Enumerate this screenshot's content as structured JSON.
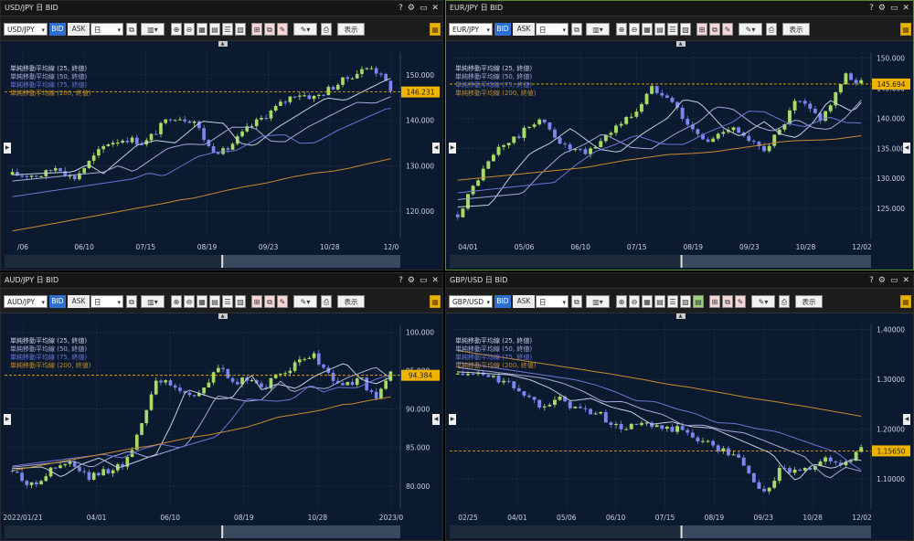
{
  "colors": {
    "bg": "#0b1a2e",
    "grid": "#24364f",
    "bull": "#a6dc66",
    "bear": "#7b86f0",
    "ma25": "#c7d0e3",
    "ma50": "#a7a9dc",
    "ma75": "#6f74d8",
    "ma200": "#c58b2e",
    "price": "#f0b400",
    "axis": "#c9d3e0"
  },
  "common": {
    "bid": "BID",
    "ask": "ASK",
    "period": "日",
    "display": "表示",
    "help": "?",
    "settings": "⚙",
    "window": "▭",
    "close": "✕",
    "legend": [
      "単純移動平均線 (25, 終値)",
      "単純移動平均線 (50, 終値)",
      "単純移動平均線 (75, 終値)",
      "単純移動平均線 (200, 終値)"
    ]
  },
  "panels": [
    {
      "title": "USD/JPY 日 BID",
      "symbol": "USD/JPY",
      "ylim": [
        114,
        155
      ],
      "yticks": [
        "120.000",
        "130.000",
        "140.000",
        "150.000"
      ],
      "ytickvals": [
        120,
        130,
        140,
        150
      ],
      "xticks": [
        "/06",
        "06/10",
        "07/15",
        "08/19",
        "09/23",
        "10/28",
        "12/0"
      ],
      "price": "146.231",
      "price_val": 146.231,
      "ma_ends": [
        144.5,
        143,
        140.5,
        131
      ],
      "ma_starts": [
        128,
        125,
        120,
        115
      ],
      "chart_data": {
        "type": "candlestick",
        "title": "USD/JPY 日 BID",
        "series": [
          {
            "name": "単純移動平均線 (25, 終値)"
          },
          {
            "name": "単純移動平均線 (50, 終値)"
          },
          {
            "name": "単純移動平均線 (75, 終値)"
          },
          {
            "name": "単純移動平均線 (200, 終値)"
          }
        ],
        "path": [
          [
            0,
            128
          ],
          [
            0.08,
            128
          ],
          [
            0.12,
            130
          ],
          [
            0.16,
            127
          ],
          [
            0.25,
            135
          ],
          [
            0.3,
            136
          ],
          [
            0.35,
            135
          ],
          [
            0.42,
            141
          ],
          [
            0.48,
            140
          ],
          [
            0.52,
            134
          ],
          [
            0.56,
            133
          ],
          [
            0.62,
            138
          ],
          [
            0.7,
            143
          ],
          [
            0.75,
            146
          ],
          [
            0.8,
            145
          ],
          [
            0.86,
            148
          ],
          [
            0.9,
            150
          ],
          [
            0.95,
            152
          ],
          [
            1.0,
            147
          ]
        ],
        "last": 146.231
      }
    },
    {
      "title": "EUR/JPY 日 BID",
      "symbol": "EUR/JPY",
      "ylim": [
        120,
        151
      ],
      "yticks": [
        "125.000",
        "130.000",
        "135.000",
        "140.000",
        "145.000",
        "150.000"
      ],
      "ytickvals": [
        125,
        130,
        135,
        140,
        145,
        150
      ],
      "xticks": [
        "04/01",
        "05/06",
        "06/10",
        "07/15",
        "08/19",
        "09/23",
        "10/28",
        "12/02"
      ],
      "price": "145.694",
      "price_val": 145.694,
      "ma_ends": [
        144.5,
        143,
        142,
        137
      ],
      "ma_starts": [
        129,
        129.5,
        130,
        130
      ],
      "chart_data": {
        "type": "candlestick",
        "title": "EUR/JPY 日 BID",
        "series": [
          {
            "name": "単純移動平均線 (25, 終値)"
          },
          {
            "name": "単純移動平均線 (50, 終値)"
          },
          {
            "name": "単純移動平均線 (75, 終値)"
          },
          {
            "name": "単純移動平均線 (200, 終値)"
          }
        ],
        "path": [
          [
            0,
            124
          ],
          [
            0.05,
            130
          ],
          [
            0.1,
            135
          ],
          [
            0.15,
            137
          ],
          [
            0.2,
            140
          ],
          [
            0.27,
            135
          ],
          [
            0.32,
            134
          ],
          [
            0.38,
            138
          ],
          [
            0.44,
            141
          ],
          [
            0.48,
            145
          ],
          [
            0.52,
            144
          ],
          [
            0.58,
            138
          ],
          [
            0.62,
            136
          ],
          [
            0.68,
            139
          ],
          [
            0.72,
            136
          ],
          [
            0.76,
            135
          ],
          [
            0.8,
            138
          ],
          [
            0.84,
            143
          ],
          [
            0.88,
            141
          ],
          [
            0.9,
            140
          ],
          [
            0.93,
            143
          ],
          [
            0.96,
            147
          ],
          [
            1.0,
            146
          ]
        ],
        "last": 145.694
      }
    },
    {
      "title": "AUD/JPY 日 BID",
      "symbol": "AUD/JPY",
      "ylim": [
        77,
        101
      ],
      "yticks": [
        "80.000",
        "85.000",
        "90.000",
        "95.000",
        "100.000"
      ],
      "ytickvals": [
        80,
        85,
        90,
        95,
        100
      ],
      "xticks": [
        "2022/01/21",
        "04/01",
        "06/10",
        "08/19",
        "10/28",
        "2023/0"
      ],
      "price": "94.384",
      "price_val": 94.384,
      "ma_ends": [
        94.5,
        94,
        93.5,
        91.5
      ],
      "ma_starts": [
        83,
        83,
        83,
        82
      ],
      "chart_data": {
        "type": "candlestick",
        "title": "AUD/JPY 日 BID",
        "series": [
          {
            "name": "単純移動平均線 (25, 終値)"
          },
          {
            "name": "単純移動平均線 (50, 終値)"
          },
          {
            "name": "単純移動平均線 (75, 終値)"
          },
          {
            "name": "単純移動平均線 (200, 終値)"
          }
        ],
        "path": [
          [
            0,
            82
          ],
          [
            0.05,
            80
          ],
          [
            0.1,
            82
          ],
          [
            0.15,
            83
          ],
          [
            0.2,
            81
          ],
          [
            0.25,
            82
          ],
          [
            0.3,
            83
          ],
          [
            0.34,
            88
          ],
          [
            0.38,
            94
          ],
          [
            0.42,
            93
          ],
          [
            0.46,
            92
          ],
          [
            0.5,
            92
          ],
          [
            0.55,
            96
          ],
          [
            0.58,
            93
          ],
          [
            0.62,
            94
          ],
          [
            0.67,
            93
          ],
          [
            0.72,
            95
          ],
          [
            0.76,
            96
          ],
          [
            0.8,
            97
          ],
          [
            0.84,
            94
          ],
          [
            0.88,
            93
          ],
          [
            0.92,
            94
          ],
          [
            0.96,
            91
          ],
          [
            1.0,
            95
          ]
        ],
        "last": 94.384
      }
    },
    {
      "title": "GBP/USD 日 BID",
      "symbol": "GBP/USD",
      "ylim": [
        1.04,
        1.41
      ],
      "yticks": [
        "1.10000",
        "1.20000",
        "1.30000",
        "1.40000"
      ],
      "ytickvals": [
        1.1,
        1.2,
        1.3,
        1.4
      ],
      "xticks": [
        "02/25",
        "04/01",
        "05/06",
        "06/10",
        "07/15",
        "08/19",
        "09/23",
        "10/28",
        "12/02"
      ],
      "price": "1.15650",
      "price_val": 1.1565,
      "ma_ends": [
        1.14,
        1.12,
        1.15,
        1.23
      ],
      "ma_starts": [
        1.33,
        1.34,
        1.35,
        1.36
      ],
      "chart_data": {
        "type": "candlestick",
        "title": "GBP/USD 日 BID",
        "series": [
          {
            "name": "単純移動平均線 (25, 終値)"
          },
          {
            "name": "単純移動平均線 (50, 終値)"
          },
          {
            "name": "単純移動平均線 (75, 終値)"
          },
          {
            "name": "単純移動平均線 (200, 終値)"
          }
        ],
        "path": [
          [
            0,
            1.31
          ],
          [
            0.05,
            1.31
          ],
          [
            0.1,
            1.3
          ],
          [
            0.15,
            1.28
          ],
          [
            0.2,
            1.25
          ],
          [
            0.25,
            1.26
          ],
          [
            0.3,
            1.24
          ],
          [
            0.35,
            1.23
          ],
          [
            0.4,
            1.2
          ],
          [
            0.45,
            1.21
          ],
          [
            0.5,
            1.2
          ],
          [
            0.55,
            1.2
          ],
          [
            0.6,
            1.18
          ],
          [
            0.65,
            1.16
          ],
          [
            0.7,
            1.14
          ],
          [
            0.73,
            1.1
          ],
          [
            0.76,
            1.07
          ],
          [
            0.8,
            1.12
          ],
          [
            0.85,
            1.11
          ],
          [
            0.9,
            1.14
          ],
          [
            0.95,
            1.13
          ],
          [
            1.0,
            1.157
          ]
        ],
        "last": 1.1565
      }
    }
  ]
}
